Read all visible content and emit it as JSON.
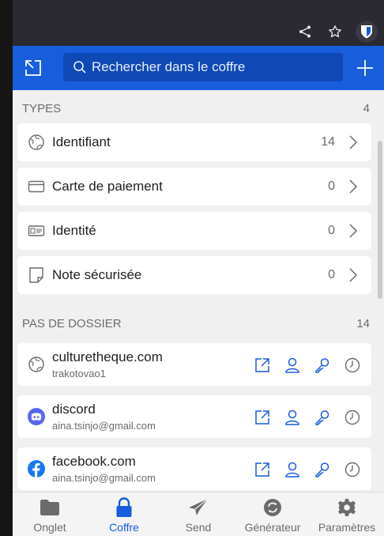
{
  "header": {
    "search_placeholder": "Rechercher dans le coffre"
  },
  "types": {
    "title": "TYPES",
    "count": "4",
    "items": [
      {
        "label": "Identifiant",
        "count": "14"
      },
      {
        "label": "Carte de paiement",
        "count": "0"
      },
      {
        "label": "Identité",
        "count": "0"
      },
      {
        "label": "Note sécurisée",
        "count": "0"
      }
    ]
  },
  "folder": {
    "title": "PAS DE DOSSIER",
    "count": "14",
    "items": [
      {
        "name": "culturetheque.com",
        "sub": "trakotovao1"
      },
      {
        "name": "discord",
        "sub": "aina.tsinjo@gmail.com"
      },
      {
        "name": "facebook.com",
        "sub": "aina.tsinjo@gmail.com"
      }
    ]
  },
  "nav": {
    "items": [
      {
        "label": "Onglet"
      },
      {
        "label": "Coffre"
      },
      {
        "label": "Send"
      },
      {
        "label": "Générateur"
      },
      {
        "label": "Paramètres"
      }
    ]
  },
  "colors": {
    "accent": "#175ddc",
    "discord": "#5865f2",
    "facebook": "#1877f2"
  }
}
